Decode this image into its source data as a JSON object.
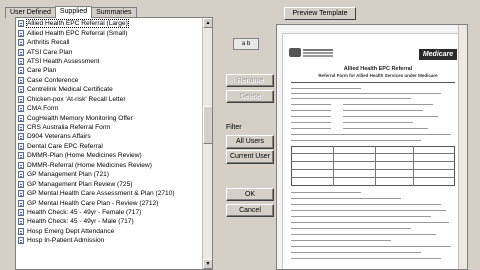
{
  "tabs": [
    {
      "label": "User Defined",
      "active": false
    },
    {
      "label": "Supplied",
      "active": true
    },
    {
      "label": "Summaries",
      "active": false
    }
  ],
  "list": {
    "items": [
      "Allied Health EPC Referral (Large)",
      "Allied Health EPC Referral (Small)",
      "Arthritis Recall",
      "ATSI Care Plan",
      "ATSI Health Assessment",
      "Care Plan",
      "Case Conference",
      "Centrelink Medical Certificate",
      "Chicken-pox 'At-risk' Recall Letter",
      "CMA Form",
      "CogHealth Memory Monitoring Offer",
      "CRS Australia Referral Form",
      "D904 Veterans Affairs",
      "Dental Care EPC Referral",
      "DMMR-Plan (Home Medicines Review)",
      "DMMR-Referral (Home Medicines Review)",
      "GP Management Plan (721)",
      "GP Management Plan Review (725)",
      "GP Mental Health Care Assessment & Plan (2710)",
      "GP Mental Health Care Plan - Review (2712)",
      "Health Check: 45 - 49yr - Female (717)",
      "Health Check: 45 - 49yr - Male (717)",
      "Hosp Emerg Dept Attendance",
      "Hosp In-Patient Admission"
    ],
    "selected_index": 0
  },
  "controls": {
    "icon_text": "a b",
    "rename_label": "Rename",
    "delete_label": "Delete",
    "filter_label": "Filter",
    "all_users_label": "All Users",
    "current_user_label": "Current User",
    "ok_label": "OK",
    "cancel_label": "Cancel",
    "preview_label": "Preview Template"
  },
  "preview": {
    "title": "Allied Health EPC Referral",
    "subtitle": "Referral Form for Allied Health Services under Medicare",
    "brand": "Medicare"
  },
  "colors": {
    "window_bg": "#d4d0c8",
    "list_bg": "#ffffff"
  }
}
